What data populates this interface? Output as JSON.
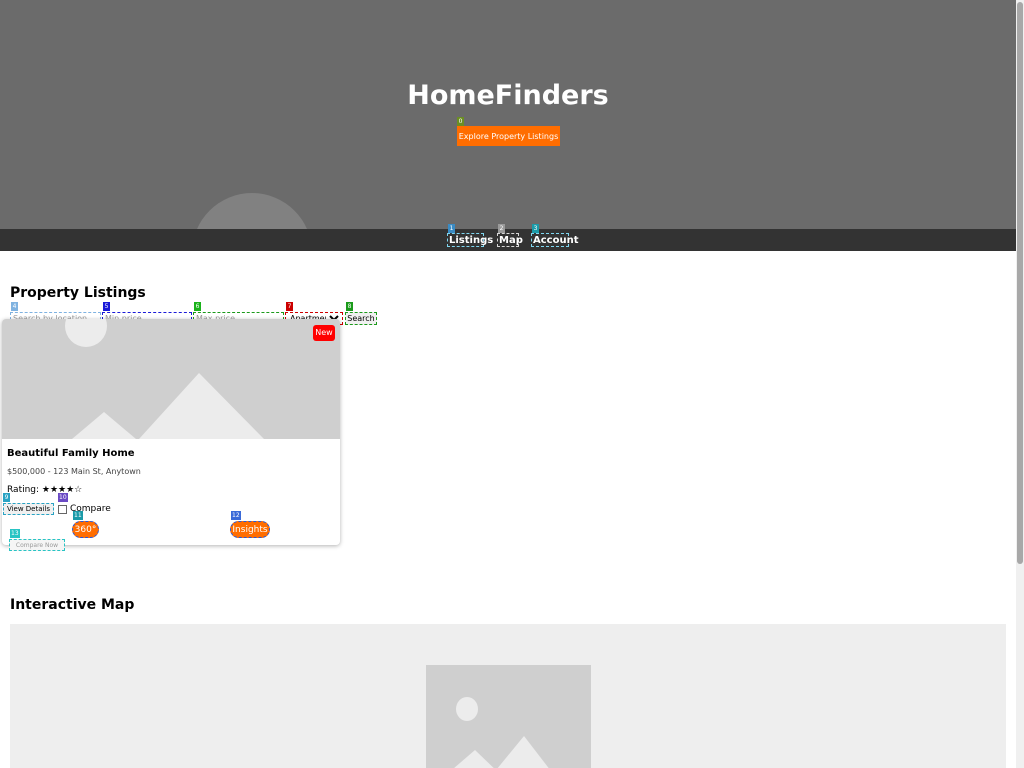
{
  "hero": {
    "title": "HomeFinders",
    "cta_label": "Explore Property Listings"
  },
  "nav": {
    "items": [
      {
        "label": "Listings"
      },
      {
        "label": "Map"
      },
      {
        "label": "Account"
      }
    ]
  },
  "listings": {
    "heading": "Property Listings",
    "filters": {
      "location_placeholder": "Search by location",
      "min_price_placeholder": "Min price",
      "max_price_placeholder": "Max price",
      "type_selected": "Apartment",
      "search_label": "Search"
    },
    "card": {
      "badge": "New",
      "title": "Beautiful Family Home",
      "meta": "$500,000 - 123 Main St, Anytown",
      "rating_label": "Rating: ★★★★☆",
      "view_details_label": "View Details",
      "compare_label": "Compare",
      "tour_label": "360°",
      "insights_label": "Insights",
      "compare_now_label": "Compare Now"
    }
  },
  "map": {
    "heading": "Interactive Map"
  },
  "markers": [
    "0",
    "1",
    "2",
    "3",
    "4",
    "5",
    "6",
    "7",
    "8",
    "9",
    "10",
    "11",
    "12",
    "13"
  ],
  "colors": {
    "accent": "#ff6d00",
    "hero_bg": "#6b6b6b",
    "nav_bg": "#333333",
    "badge_new": "#ff0000"
  }
}
